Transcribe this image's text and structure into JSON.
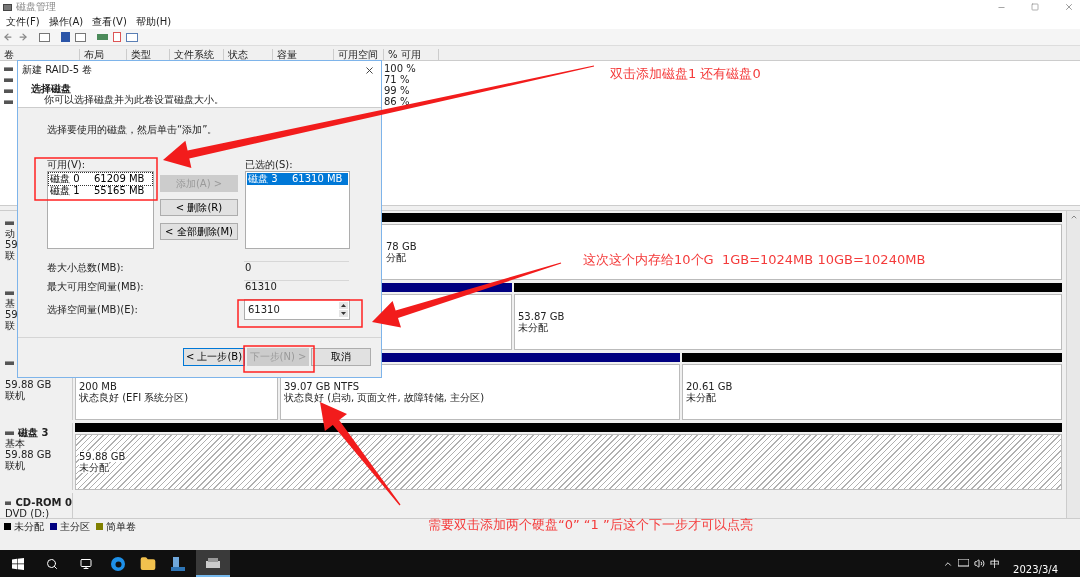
{
  "window": {
    "title": "磁盘管理"
  },
  "menu": [
    {
      "label": "文件(F)"
    },
    {
      "label": "操作(A)"
    },
    {
      "label": "查看(V)"
    },
    {
      "label": "帮助(H)"
    }
  ],
  "volume_table": {
    "columns": [
      "卷",
      "布局",
      "类型",
      "文件系统",
      "状态",
      "容量",
      "可用空间",
      "% 可用"
    ],
    "rows": [
      {
        "percent_free": "100 %"
      },
      {
        "percent_free": "71 %"
      },
      {
        "percent_free": "99 %"
      },
      {
        "percent_free": "86 %"
      }
    ]
  },
  "disks": [
    {
      "lines": [
        "动",
        "59",
        "联"
      ],
      "partitions": [
        {
          "kind": "unallocated",
          "selected": false,
          "lines": [
            "78 GB",
            "分配"
          ]
        }
      ]
    },
    {
      "lines": [
        "基",
        "59",
        "联"
      ],
      "partitions": [
        {
          "kind": "primary",
          "selected": false
        },
        {
          "kind": "unallocated",
          "selected": false,
          "lines": [
            "53.87 GB",
            "未分配"
          ]
        }
      ]
    },
    {
      "lines": [
        "59.88 GB",
        "联机"
      ],
      "partitions": [
        {
          "selected": false,
          "lines": [
            "200 MB",
            "状态良好 (EFI 系统分区)"
          ]
        },
        {
          "kind": "primary",
          "selected": false,
          "lines": [
            "39.07 GB NTFS",
            "状态良好 (启动, 页面文件, 故障转储, 主分区)"
          ]
        },
        {
          "kind": "unallocated",
          "selected": false,
          "lines": [
            "20.61 GB",
            "未分配"
          ]
        }
      ]
    },
    {
      "name": "磁盘 3",
      "lines": [
        "基本",
        "59.88 GB",
        "联机"
      ],
      "partitions": [
        {
          "kind": "unallocated",
          "selected": true,
          "lines": [
            "59.88 GB",
            "未分配"
          ]
        }
      ]
    },
    {
      "name": "CD-ROM 0",
      "lines": [
        "DVD (D:)"
      ]
    }
  ],
  "legend": [
    {
      "label": "未分配",
      "color": "#000000"
    },
    {
      "label": "主分区",
      "color": "#000080"
    },
    {
      "label": "简单卷",
      "color": "#808000"
    }
  ],
  "dialog": {
    "title": "新建 RAID-5 卷",
    "heading": "选择磁盘",
    "subheading": "你可以选择磁盘并为此卷设置磁盘大小。",
    "instruction": "选择要使用的磁盘，然后单击“添加”。",
    "available": {
      "label": "可用(V):",
      "items": [
        {
          "name": "磁盘 0",
          "size": "61209 MB",
          "selected": false,
          "focused": true
        },
        {
          "name": "磁盘 1",
          "size": "55165 MB",
          "selected": false,
          "focused": false
        }
      ]
    },
    "move_buttons": [
      {
        "label": "添加(A) >",
        "disabled": true
      },
      {
        "label": "< 删除(R)",
        "disabled": false
      },
      {
        "label": "< 全部删除(M)",
        "disabled": false
      }
    ],
    "chosen": {
      "label": "已选的(S):",
      "items": [
        {
          "name": "磁盘 3",
          "size": "61310 MB",
          "selected": true,
          "focused": false
        }
      ]
    },
    "fields": [
      {
        "kind": "readonly",
        "label": "卷大小总数(MB):",
        "value": "0"
      },
      {
        "kind": "readonly",
        "label": "最大可用空间量(MB):",
        "value": "61310"
      },
      {
        "kind": "spin",
        "label": "选择空间量(MB)(E):",
        "value": "61310"
      }
    ],
    "footer_buttons": [
      {
        "label": "< 上一步(B)",
        "disabled": false,
        "focused": true
      },
      {
        "label": "下一步(N) >",
        "disabled": true,
        "focused": false
      },
      {
        "label": "取消",
        "disabled": false,
        "focused": false
      }
    ]
  },
  "annotations": [
    {
      "text": "双击添加磁盘1 还有磁盘0"
    },
    {
      "text": "这次这个内存给10个G  1GB=1024MB 10GB=10240MB"
    },
    {
      "text": "需要双击添加两个硬盘“0” “1 ”后这个下一步才可以点亮"
    }
  ],
  "taskbar": {
    "ime": "中",
    "date": "2023/3/4"
  }
}
